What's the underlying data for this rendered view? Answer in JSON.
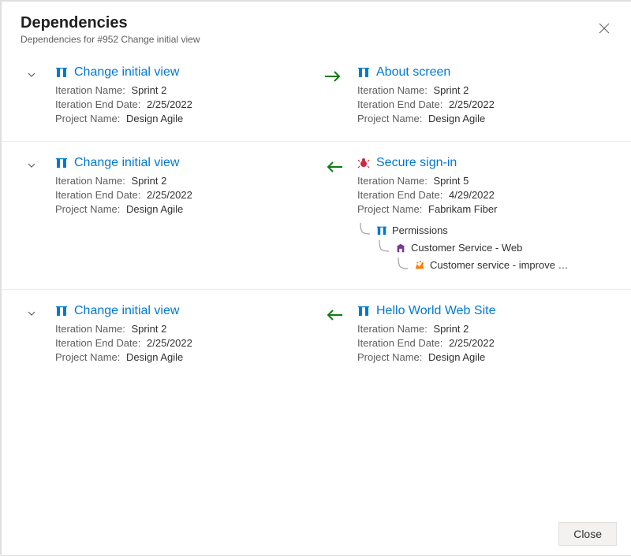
{
  "header": {
    "title": "Dependencies",
    "subtitle": "Dependencies for #952 Change initial view"
  },
  "labels": {
    "iteration_name": "Iteration Name:",
    "iteration_end": "Iteration End Date:",
    "project_name": "Project Name:"
  },
  "rows": [
    {
      "direction": "right",
      "left": {
        "icon": "user-story",
        "title": "Change initial view",
        "iteration_name": "Sprint 2",
        "iteration_end": "2/25/2022",
        "project_name": "Design Agile"
      },
      "right": {
        "icon": "user-story",
        "title": "About screen",
        "iteration_name": "Sprint 2",
        "iteration_end": "2/25/2022",
        "project_name": "Design Agile"
      }
    },
    {
      "direction": "left",
      "left": {
        "icon": "user-story",
        "title": "Change initial view",
        "iteration_name": "Sprint 2",
        "iteration_end": "2/25/2022",
        "project_name": "Design Agile"
      },
      "right": {
        "icon": "bug",
        "title": "Secure sign-in",
        "iteration_name": "Sprint 5",
        "iteration_end": "4/29/2022",
        "project_name": "Fabrikam Fiber",
        "tree": [
          {
            "indent": 1,
            "icon": "user-story",
            "title": "Permissions"
          },
          {
            "indent": 2,
            "icon": "feature",
            "title": "Customer Service - Web"
          },
          {
            "indent": 3,
            "icon": "epic",
            "title": "Customer service - improve …"
          }
        ]
      }
    },
    {
      "direction": "left",
      "left": {
        "icon": "user-story",
        "title": "Change initial view",
        "iteration_name": "Sprint 2",
        "iteration_end": "2/25/2022",
        "project_name": "Design Agile"
      },
      "right": {
        "icon": "user-story",
        "title": "Hello World Web Site",
        "iteration_name": "Sprint 2",
        "iteration_end": "2/25/2022",
        "project_name": "Design Agile"
      }
    }
  ],
  "footer": {
    "close_label": "Close"
  },
  "icons": {
    "user-story": "#0078d4",
    "bug": "#cc293d",
    "feature": "#773b93",
    "epic": "#ff7b00"
  }
}
